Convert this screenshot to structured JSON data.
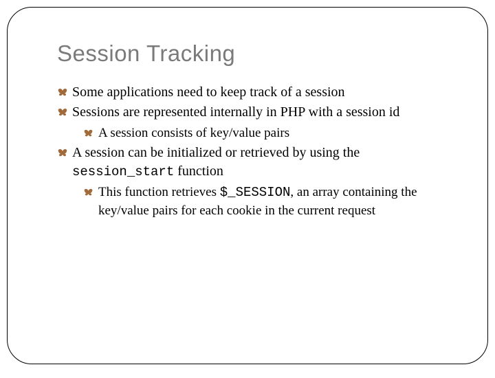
{
  "title": "Session Tracking",
  "bullets": {
    "b1": "Some applications need to keep track of a session",
    "b2": "Sessions are represented internally in PHP with a session id",
    "b2_1": "A session consists of key/value pairs",
    "b3_pre": "A session can be initialized or retrieved by using the ",
    "b3_code": "session_start",
    "b3_post": " function",
    "b3_1_pre": "This function retrieves ",
    "b3_1_code": "$_SESSION",
    "b3_1_post": ", an array containing the key/value pairs for each cookie in the current request"
  }
}
